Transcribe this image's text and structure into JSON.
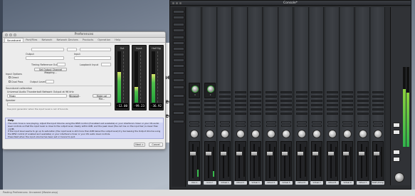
{
  "preferences": {
    "window_title": "Preferences",
    "tabs": [
      "Soundcard",
      "Port/Files",
      "Network",
      "Network Devices",
      "Products",
      "Operation",
      "Help"
    ],
    "active_tab": 0,
    "labels": {
      "timing_ref": "Timing Reference Output",
      "set_output_channel": "Set Output Channel Mapping...",
      "loopback": "Loopback Input",
      "output": "Output",
      "input": "Input",
      "input_options": "Input Options",
      "direct": "Direct",
      "dual_pass": "Dual Pass",
      "output_level": "Output Level",
      "soundcard_calibration": "Soundcard calibration",
      "calibration_desc": "Universal Audio Thunderbolt Network Output at 96 kHz",
      "calibration_value": "Music",
      "browse": "Browse...",
      "make_cal_file": "Make cal File...",
      "speaker": "Speaker",
      "checkbox_hint": "Use pink generator when the input level is out of bounds"
    },
    "meters": [
      {
        "caption": "Out",
        "readout": "-12.00",
        "level": 0.6
      },
      {
        "caption": "Input",
        "readout": "-99.23",
        "level": 0.3
      },
      {
        "caption": "Half Sig",
        "readout": "-36.92",
        "level": 0.55
      }
    ],
    "help": {
      "title": "Help",
      "paragraphs": [
        "The violin tone is now playing. Adjust the Input Volume using the REW control (if enabled and available) or your interface's mixer or your OS audio level controls so that the input level is close to the output level, ideally within 6dB, and the peak level (the red line on the input bar) is lower than -12dB.",
        "If the input level seems to go up to saturation (the input level is still more than 6dB below the output level) try decreasing the Output Volume using the REW control (if enabled and available) or your interface's mixer or your OS audio level controls.",
        "Press Next when the input volume has been set or Cancel to quit."
      ]
    },
    "buttons": {
      "next": "Next >",
      "cancel": "Cancel"
    }
  },
  "background_page": {
    "fragments": [
      "ne",
      "led",
      "led"
    ]
  },
  "console": {
    "title": "Console*",
    "channels": [
      {
        "name": "Unix 1",
        "has_preamp": true,
        "preamp_value": "0",
        "fader": 0.78,
        "level": 0.25
      },
      {
        "name": "Unix 2",
        "has_preamp": true,
        "preamp_value": "0",
        "fader": 0.78,
        "level": 0.2
      },
      {
        "name": "Virtual 1",
        "has_preamp": false,
        "fader": 0.78,
        "level": 0
      },
      {
        "name": "Virtual 2",
        "has_preamp": false,
        "fader": 0.78,
        "level": 0
      },
      {
        "name": "Virtual 3",
        "has_preamp": false,
        "fader": 0.78,
        "level": 0
      },
      {
        "name": "Virtual 4",
        "has_preamp": false,
        "fader": 0.78,
        "level": 0
      },
      {
        "name": "Virtual 5",
        "has_preamp": false,
        "fader": 0.78,
        "level": 0
      },
      {
        "name": "Virtual 6",
        "has_preamp": false,
        "fader": 0.78,
        "level": 0
      },
      {
        "name": "Virtual 7",
        "has_preamp": false,
        "fader": 0.78,
        "level": 0
      },
      {
        "name": "Virtual 8",
        "has_preamp": false,
        "fader": 0.78,
        "level": 0
      },
      {
        "name": "Virtual 9",
        "has_preamp": false,
        "fader": 0.78,
        "level": 0
      },
      {
        "name": "Virtual 7",
        "has_preamp": false,
        "fader": 0.78,
        "level": 0
      },
      {
        "name": "ADAT (Entry)",
        "has_preamp": false,
        "fader": 0.78,
        "level": 0
      }
    ],
    "master": {
      "left_level": 0.72,
      "right_level": 0.68
    },
    "colors": {
      "meter_green": "#37b94b",
      "preamp_ring": "#3faa3f"
    }
  },
  "footer": {
    "text": "Pasting Preferences: Unnamed (Master.wcp)"
  }
}
